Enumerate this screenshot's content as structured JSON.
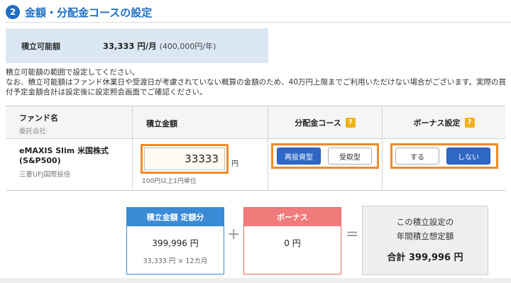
{
  "heading": {
    "step": "2",
    "title": "金額・分配金コースの設定"
  },
  "available": {
    "label": "積立可能額",
    "value": "33,333 円/月",
    "sub": "(400,000円/年)"
  },
  "note": {
    "line1": "積立可能額の範囲で設定してください。",
    "line2": "なお、積立可能額はファンド休業日や受渡日が考慮されていない概算の金額のため、40万円上限までご利用いただけない場合がございます。実際の買付予定金額合計は設定後に設定照会画面でご確認ください。"
  },
  "table": {
    "headers": {
      "fund": "ファンド名",
      "fund_sub": "委託会社",
      "amount": "積立金額",
      "course": "分配金コース",
      "bonus": "ボーナス設定",
      "help": "?"
    },
    "row": {
      "fund_name": "eMAXIS Slim 米国株式 (S&P500)",
      "company": "三菱UFJ国際投信",
      "amount_value": "33333",
      "amount_unit": "円",
      "amount_hint": "100円以上1円単位",
      "course_options": [
        "再投資型",
        "受取型"
      ],
      "course_selected": "再投資型",
      "bonus_options": [
        "する",
        "しない"
      ],
      "bonus_selected": "しない"
    }
  },
  "summary": {
    "regular": {
      "title": "積立金額 定額分",
      "value": "399,996 円",
      "detail": "33,333 円 × 12カ月"
    },
    "bonus": {
      "title": "ボーナス",
      "value": "0 円"
    },
    "plus": "+",
    "equals": "=",
    "result": {
      "line1": "この積立設定の",
      "line2": "年間積立想定額",
      "total": "合計 399,996 円"
    }
  },
  "colors": {
    "accent": "#1e6fc4",
    "highlight": "#f08a2a",
    "selected": "#2f67c5",
    "bonus": "#f07b7b"
  }
}
